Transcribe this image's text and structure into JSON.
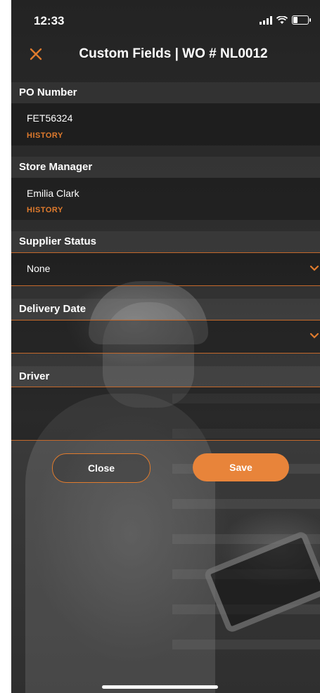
{
  "status_bar": {
    "time": "12:33"
  },
  "header": {
    "title": "Custom Fields | WO # NL0012"
  },
  "fields": {
    "po_number": {
      "label": "PO Number",
      "value": "FET56324",
      "history": "HISTORY"
    },
    "store_manager": {
      "label": "Store Manager",
      "value": "Emilia Clark",
      "history": "HISTORY"
    },
    "supplier_status": {
      "label": "Supplier Status",
      "value": "None"
    },
    "delivery_date": {
      "label": "Delivery Date",
      "value": ""
    },
    "driver": {
      "label": "Driver",
      "value": ""
    }
  },
  "buttons": {
    "close": "Close",
    "save": "Save"
  },
  "colors": {
    "accent": "#e07b2d",
    "save_fill": "#e8843a",
    "text": "#ffffff"
  },
  "icons": [
    "close-icon",
    "chevron-down-icon",
    "signal-icon",
    "wifi-icon",
    "battery-icon"
  ]
}
